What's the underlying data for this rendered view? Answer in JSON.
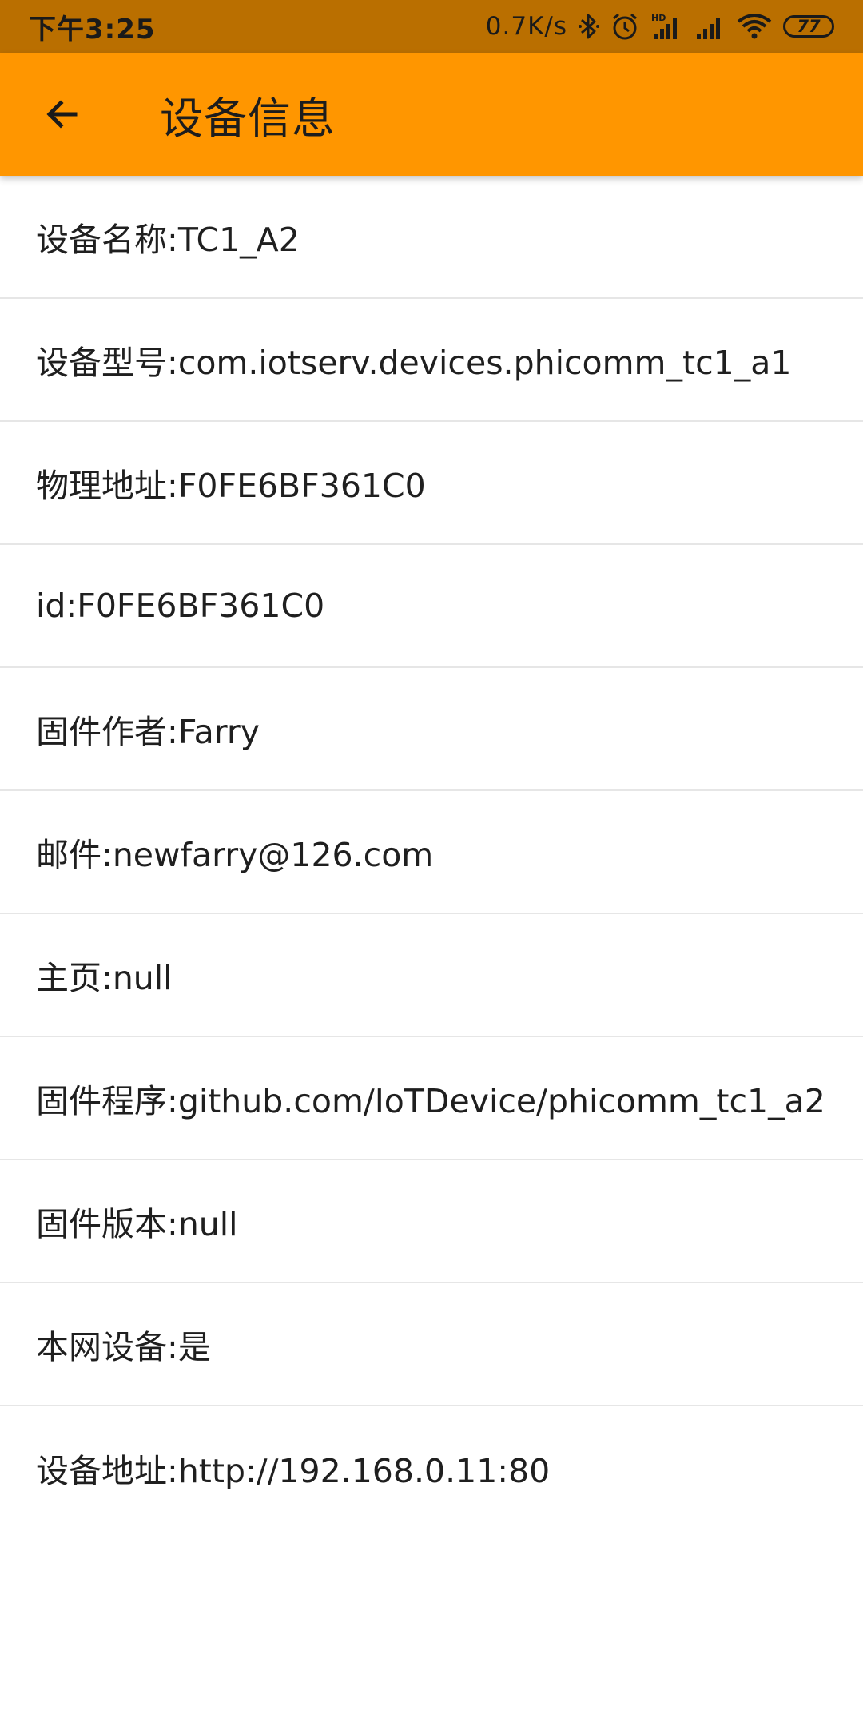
{
  "status_bar": {
    "time": "下午3:25",
    "net_speed": "0.7K/s",
    "battery": "77",
    "icons": [
      "bluetooth-icon",
      "alarm-icon",
      "hd-signal-icon",
      "signal-icon",
      "wifi-icon",
      "battery-icon"
    ]
  },
  "app_bar": {
    "title": "设备信息",
    "back_icon": "arrow-back-icon",
    "background": "#ff9600"
  },
  "items": [
    {
      "label": "设备名称:TC1_A2"
    },
    {
      "label": "设备型号:com.iotserv.devices.phicomm_tc1_a1"
    },
    {
      "label": "物理地址:F0FE6BF361C0"
    },
    {
      "label": "id:F0FE6BF361C0"
    },
    {
      "label": "固件作者:Farry"
    },
    {
      "label": "邮件:newfarry@126.com"
    },
    {
      "label": "主页:null"
    },
    {
      "label": "固件程序:github.com/IoTDevice/phicomm_tc1_a2"
    },
    {
      "label": "固件版本:null"
    },
    {
      "label": "本网设备:是"
    },
    {
      "label": "设备地址:http://192.168.0.11:80"
    }
  ]
}
